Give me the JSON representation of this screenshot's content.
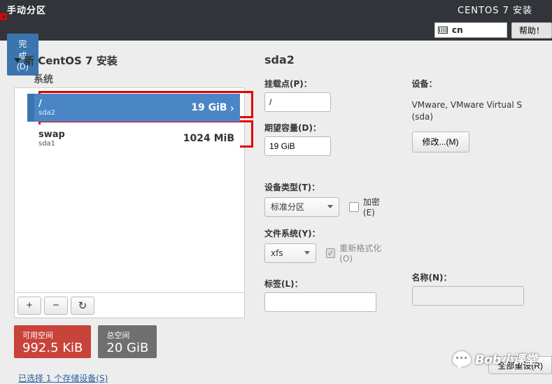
{
  "header": {
    "title_left": "手动分区",
    "title_right": "CENTOS 7 安装",
    "done": "完成(D)",
    "kb_layout": "cn",
    "help": "帮助！"
  },
  "tree": {
    "title": "新 CentOS 7 安装",
    "group": "系统",
    "items": [
      {
        "mount": "/",
        "dev": "sda2",
        "size": "19 GiB",
        "selected": true
      },
      {
        "mount": "swap",
        "dev": "sda1",
        "size": "1024 MiB",
        "selected": false
      }
    ]
  },
  "toolbar": {
    "add": "+",
    "remove": "−",
    "reload": "↻"
  },
  "space": {
    "avail_label": "可用空间",
    "avail_value": "992.5 KiB",
    "total_label": "总空间",
    "total_value": "20 GiB"
  },
  "storage_link": "已选择 1 个存储设备(S)",
  "detail": {
    "heading": "sda2",
    "mount_label": "挂载点(P)：",
    "mount_value": "/",
    "capacity_label": "期望容量(D)：",
    "capacity_value": "19 GiB",
    "device_label": "设备：",
    "device_text": "VMware, VMware Virtual S (sda)",
    "modify": "修改...(M)",
    "devtype_label": "设备类型(T)：",
    "devtype_value": "标准分区",
    "encrypt_label": "加密(E)",
    "fs_label": "文件系统(Y)：",
    "fs_value": "xfs",
    "reformat_label": "重新格式化(O)",
    "tag_label": "标签(L)：",
    "name_label": "名称(N)："
  },
  "reset": "全部重设(R)",
  "watermark": "Bob小课堂"
}
